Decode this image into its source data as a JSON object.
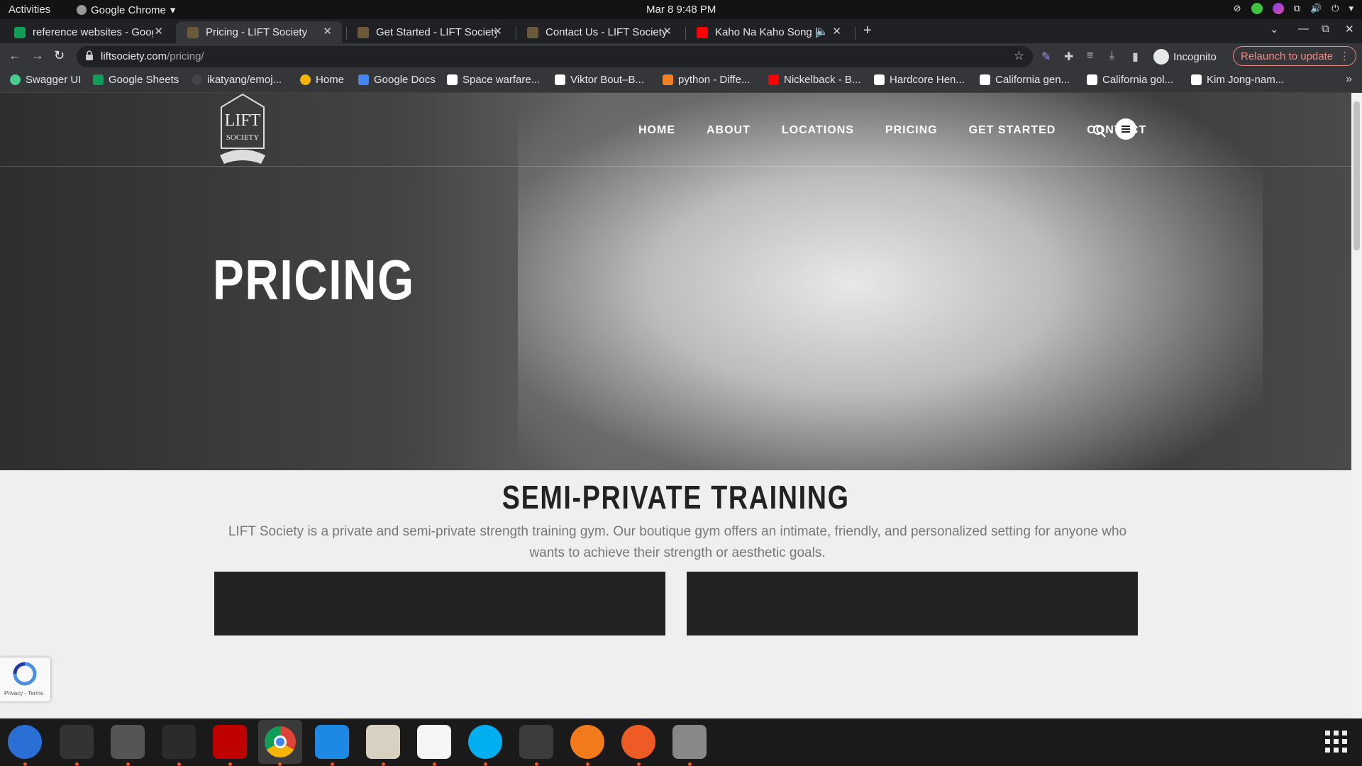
{
  "system": {
    "activities": "Activities",
    "app_name": "Google Chrome",
    "clock": "Mar 8  9:48 PM"
  },
  "tabs": [
    {
      "title": "reference websites - Goog",
      "favicon": "sheets-icon",
      "color": "#0f9d58"
    },
    {
      "title": "Pricing - LIFT Society",
      "favicon": "lift-icon",
      "color": "#6b5a3a",
      "active": true
    },
    {
      "title": "Get Started - LIFT Society",
      "favicon": "lift-icon",
      "color": "#6b5a3a"
    },
    {
      "title": "Contact Us - LIFT Society",
      "favicon": "lift-icon",
      "color": "#6b5a3a"
    },
    {
      "title": "Kaho Na Kaho Song | 4",
      "favicon": "youtube-icon",
      "color": "#ff0000"
    }
  ],
  "address": {
    "domain": "liftsociety.com",
    "path": "/pricing/"
  },
  "incognito_label": "Incognito",
  "relaunch_label": "Relaunch to update",
  "bookmarks": [
    {
      "label": "Swagger UI",
      "color": "#49cc90"
    },
    {
      "label": "Google Sheets",
      "color": "#0f9d58"
    },
    {
      "label": "ikatyang/emoj...",
      "color": "#444444"
    },
    {
      "label": "Home",
      "color": "#f4b400"
    },
    {
      "label": "Google Docs",
      "color": "#4285f4"
    },
    {
      "label": "Space warfare...",
      "color": "#ffffff"
    },
    {
      "label": "Viktor Bout–B...",
      "color": "#ffffff"
    },
    {
      "label": "python - Diffe...",
      "color": "#f48024"
    },
    {
      "label": "Nickelback - B...",
      "color": "#ff0000"
    },
    {
      "label": "Hardcore Hen...",
      "color": "#ffffff"
    },
    {
      "label": "California gen...",
      "color": "#ffffff"
    },
    {
      "label": "California gol...",
      "color": "#ffffff"
    },
    {
      "label": "Kim Jong-nam...",
      "color": "#ffffff"
    }
  ],
  "site": {
    "logo_line1": "LIFT",
    "logo_line2": "SOCIETY",
    "nav": [
      "HOME",
      "ABOUT",
      "LOCATIONS",
      "PRICING",
      "GET STARTED",
      "CONTACT"
    ],
    "hero_title": "PRICING",
    "section_title": "SEMI-PRIVATE TRAINING",
    "section_desc": "LIFT Society is a private and semi-private strength training gym. Our boutique gym offers an intimate, friendly, and personalized setting for anyone who wants to achieve their strength or aesthetic goals."
  },
  "recaptcha_terms": "Privacy - Terms",
  "dock": [
    {
      "name": "thunderbird-icon",
      "color": "#2a6fd6"
    },
    {
      "name": "terminal-icon",
      "color": "#333333"
    },
    {
      "name": "calculator-icon",
      "color": "#555555"
    },
    {
      "name": "system-monitor-icon",
      "color": "#2b2b2b"
    },
    {
      "name": "filezilla-icon",
      "color": "#bf0000"
    },
    {
      "name": "chrome-icon",
      "color": "#ffffff"
    },
    {
      "name": "vscode-icon",
      "color": "#1e88e5"
    },
    {
      "name": "files-icon",
      "color": "#d8d0c0"
    },
    {
      "name": "text-editor-icon",
      "color": "#f5f5f5"
    },
    {
      "name": "skype-icon",
      "color": "#00aff0"
    },
    {
      "name": "sublime-icon",
      "color": "#3c3c3c"
    },
    {
      "name": "blaze-icon",
      "color": "#f27a1a"
    },
    {
      "name": "postman-icon",
      "color": "#ef5b25"
    },
    {
      "name": "disk-icon",
      "color": "#888888"
    }
  ]
}
